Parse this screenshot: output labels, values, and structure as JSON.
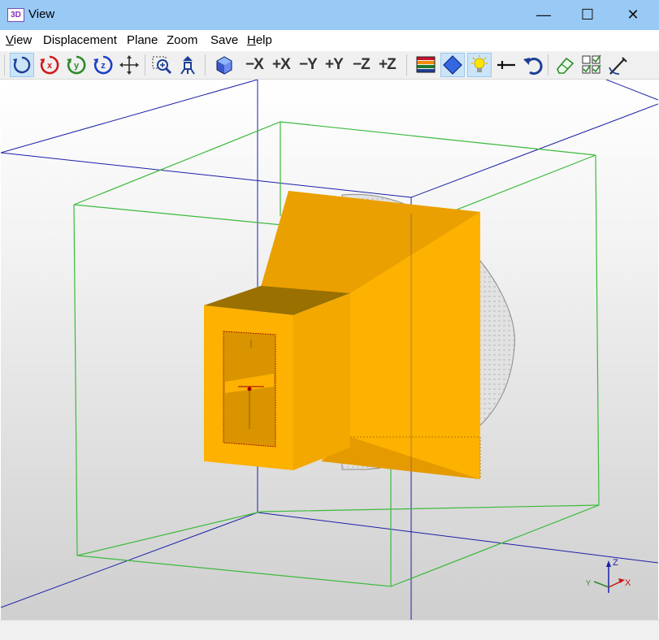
{
  "window": {
    "app_icon": "3D",
    "title": "View",
    "minimize_icon": "minimize-icon",
    "maximize_icon": "maximize-icon",
    "close_icon": "close-icon",
    "minimize_glyph": "—",
    "maximize_glyph": "☐",
    "close_glyph": "✕"
  },
  "menu": [
    {
      "label": "View",
      "underline": "V",
      "rest": "iew"
    },
    {
      "label": "Displacement"
    },
    {
      "label": "Plane"
    },
    {
      "label": "Zoom"
    },
    {
      "label": "Save"
    },
    {
      "label": "Help",
      "underline": "H",
      "rest": "elp"
    }
  ],
  "toolbar": {
    "axis_buttons": [
      "−X",
      "+X",
      "−Y",
      "+Y",
      "−Z",
      "+Z"
    ],
    "rotate_axis_labels": [
      "x",
      "y",
      "z"
    ]
  },
  "triad": {
    "z_label": "Z",
    "x_label": "X",
    "y_label": "Y"
  },
  "colors": {
    "horn_orange": "#fdb100",
    "horn_dark": "#e39c00",
    "bbox_blue": "#1b1fa8",
    "bbox_green": "#3cba3c",
    "dish_grey": "#d0d0d0"
  }
}
